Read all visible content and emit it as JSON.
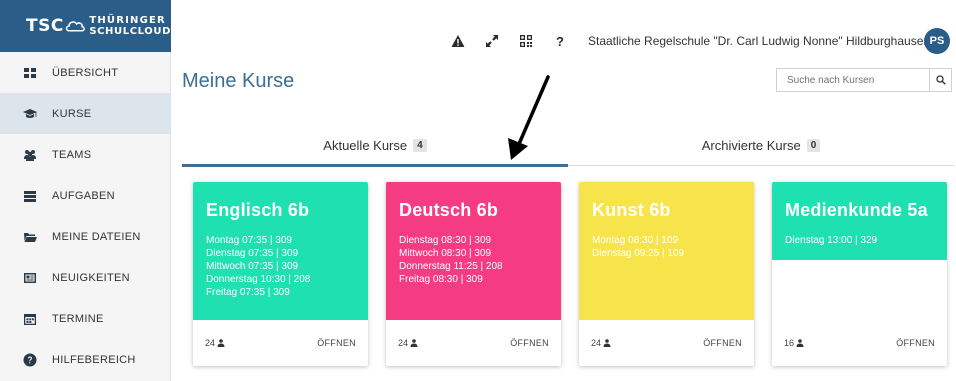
{
  "logo": {
    "abbr": "TSC",
    "line1": "THÜRINGER",
    "line2": "SCHULCLOUD"
  },
  "sidebar": {
    "items": [
      {
        "label": "ÜBERSICHT",
        "icon": "dashboard-icon"
      },
      {
        "label": "KURSE",
        "icon": "graduation-cap-icon"
      },
      {
        "label": "TEAMS",
        "icon": "users-icon"
      },
      {
        "label": "AUFGABEN",
        "icon": "tasks-icon"
      },
      {
        "label": "MEINE DATEIEN",
        "icon": "folder-icon"
      },
      {
        "label": "NEUIGKEITEN",
        "icon": "newspaper-icon"
      },
      {
        "label": "TERMINE",
        "icon": "calendar-icon"
      },
      {
        "label": "HILFEBEREICH",
        "icon": "help-circle-icon"
      }
    ]
  },
  "topbar": {
    "school": "Staatliche Regelschule \"Dr. Carl Ludwig Nonne\" Hildburghausen",
    "avatar": "PS",
    "help": "?"
  },
  "page": {
    "title": "Meine Kurse"
  },
  "search": {
    "placeholder": "Suche nach Kursen"
  },
  "tabs": [
    {
      "label": "Aktuelle Kurse",
      "count": "4"
    },
    {
      "label": "Archivierte Kurse",
      "count": "0"
    }
  ],
  "courses": [
    {
      "title": "Englisch 6b",
      "color": "#1fe0b0",
      "times": [
        "Montag 07:35 | 309",
        "Dienstag 07:35 | 309",
        "Mittwoch 07:35 | 309",
        "Donnerstag 10:30 | 208",
        "Freitag 07:35 | 309"
      ],
      "members": "24",
      "open": "ÖFFNEN"
    },
    {
      "title": "Deutsch 6b",
      "color": "#f53c82",
      "times": [
        "Dienstag 08:30 | 309",
        "Mittwoch 08:30 | 309",
        "Donnerstag 11:25 | 208",
        "Freitag 08:30 | 309"
      ],
      "members": "24",
      "open": "ÖFFNEN"
    },
    {
      "title": "Kunst 6b",
      "color": "#f7e44a",
      "times": [
        "Montag 08:30 | 109",
        "Dienstag 09:25 | 109"
      ],
      "members": "24",
      "open": "ÖFFNEN"
    },
    {
      "title": "Medienkunde 5a",
      "color": "#1fe0b0",
      "times": [
        "Dienstag 13:00 | 329"
      ],
      "members": "16",
      "open": "ÖFFNEN"
    }
  ],
  "colors": {
    "brand": "#2b5d89",
    "accent": "#3c6e97"
  }
}
